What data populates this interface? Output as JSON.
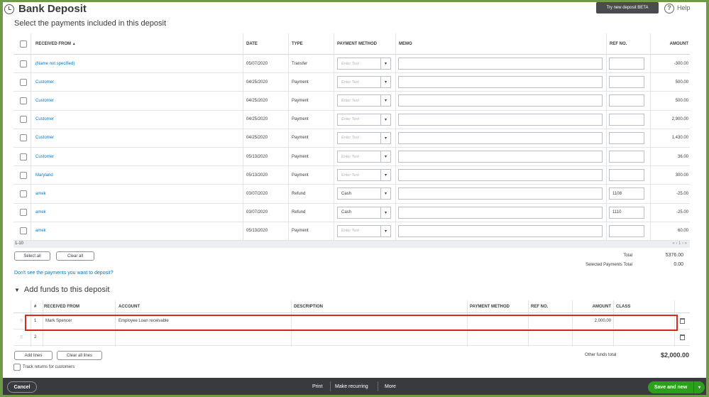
{
  "header": {
    "title": "Bank Deposit",
    "try_label": "Try new deposit BETA",
    "help_glyph": "?",
    "help_label": "Help"
  },
  "payments": {
    "section_title": "Select the payments included in this deposit",
    "columns": {
      "received_from": "RECEIVED FROM",
      "sort_indicator": "▲",
      "date": "DATE",
      "type": "TYPE",
      "payment_method": "PAYMENT METHOD",
      "memo": "MEMO",
      "ref_no": "REF NO.",
      "amount": "AMOUNT"
    },
    "placeholder": "Enter Text",
    "rows": [
      {
        "received_from": "(Name not specified)",
        "date": "05/07/2020",
        "type": "Transfer",
        "payment_method": "",
        "ref_no": "",
        "amount": "-300.00"
      },
      {
        "received_from": "Customer",
        "date": "04/25/2020",
        "type": "Payment",
        "payment_method": "",
        "ref_no": "",
        "amount": "500.00"
      },
      {
        "received_from": "Customer",
        "date": "04/25/2020",
        "type": "Payment",
        "payment_method": "",
        "ref_no": "",
        "amount": "500.00"
      },
      {
        "received_from": "Customer",
        "date": "04/25/2020",
        "type": "Payment",
        "payment_method": "",
        "ref_no": "",
        "amount": "2,900.00"
      },
      {
        "received_from": "Customer",
        "date": "04/25/2020",
        "type": "Payment",
        "payment_method": "",
        "ref_no": "",
        "amount": "1,430.00"
      },
      {
        "received_from": "Customer",
        "date": "05/13/2020",
        "type": "Payment",
        "payment_method": "",
        "ref_no": "",
        "amount": "36.00"
      },
      {
        "received_from": "Maryland",
        "date": "05/13/2020",
        "type": "Payment",
        "payment_method": "",
        "ref_no": "",
        "amount": "300.00"
      },
      {
        "received_from": "amek",
        "date": "03/07/2020",
        "type": "Refund",
        "payment_method": "Cash",
        "ref_no": "1108",
        "amount": "-25.00"
      },
      {
        "received_from": "amek",
        "date": "03/07/2020",
        "type": "Refund",
        "payment_method": "Cash",
        "ref_no": "1110",
        "amount": "-25.00"
      },
      {
        "received_from": "amek",
        "date": "05/13/2020",
        "type": "Payment",
        "payment_method": "",
        "ref_no": "",
        "amount": "60.00"
      }
    ],
    "range_label": "1-10",
    "pager": "« ‹ 1 › »",
    "select_all": "Select all",
    "clear_all": "Clear all",
    "total_label": "Total",
    "total_value": "5376.00",
    "selected_label": "Selected Payments Total",
    "selected_value": "0.00",
    "dont_see": "Don't see the payments you want to deposit?"
  },
  "funds": {
    "section_title": "Add funds to this deposit",
    "columns": {
      "num": "#",
      "received_from": "RECEIVED FROM",
      "account": "ACCOUNT",
      "description": "DESCRIPTION",
      "payment_method": "PAYMENT METHOD",
      "ref_no": "REF NO.",
      "amount": "AMOUNT",
      "class": "CLASS"
    },
    "rows": [
      {
        "num": "1",
        "received_from": "Mark Spencer",
        "account": "Employee Loan receivable",
        "description": "",
        "payment_method": "",
        "ref_no": "",
        "amount": "2,000.00",
        "class": ""
      },
      {
        "num": "2",
        "received_from": "",
        "account": "",
        "description": "",
        "payment_method": "",
        "ref_no": "",
        "amount": "",
        "class": ""
      }
    ],
    "add_lines": "Add lines",
    "clear_all_lines": "Clear all lines",
    "other_label": "Other funds total",
    "other_value": "$2,000.00",
    "track_returns": "Track returns for customers"
  },
  "footer": {
    "cancel": "Cancel",
    "print": "Print",
    "make_recurring": "Make recurring",
    "more": "More",
    "save": "Save and new",
    "save_arrow": "▾"
  },
  "colors": {
    "link": "#0077c5",
    "save_green": "#2ca01c",
    "footer_bg": "#393a3d",
    "highlight": "#d52b1e"
  }
}
